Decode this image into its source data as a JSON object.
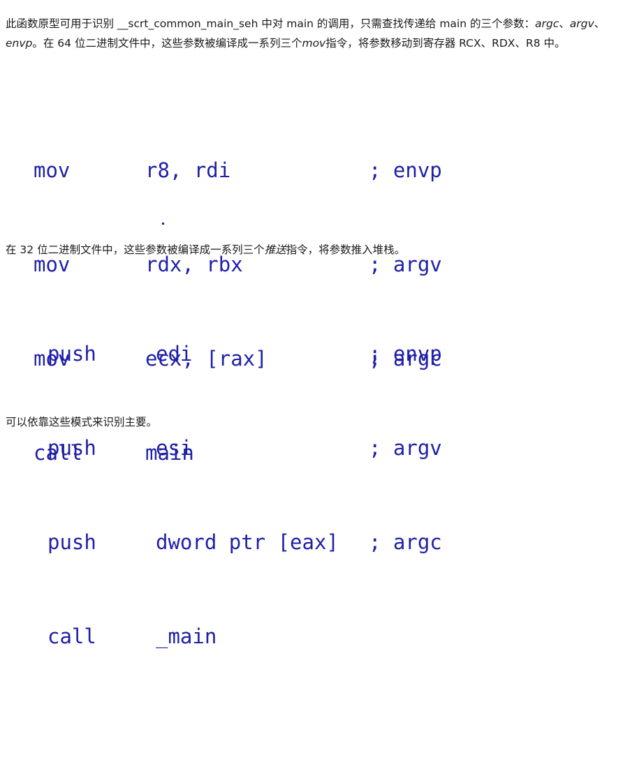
{
  "para1": {
    "a": "此函数原型可用于识别 __scrt_common_main_seh 中对 main 的调用，只需查找传递给 main 的三个参数：",
    "argc": "argc",
    "sep1": "、",
    "argv": "argv",
    "sep2": "、",
    "envp": "envp",
    "b": "。在 64 位二进制文件中，这些参数被编译成一系列三个",
    "mov": "mov",
    "c": "指令，将参数移动到寄存器 RCX、RDX、R8 中。"
  },
  "code64": [
    {
      "op": "mov",
      "args": "r8, rdi",
      "comment": "; envp"
    },
    {
      "op": "mov",
      "args": "rdx, rbx",
      "comment": "; argv"
    },
    {
      "op": "mov",
      "args": "ecx, [rax]",
      "comment": "; argc"
    },
    {
      "op": "call",
      "args": "main",
      "comment": ""
    }
  ],
  "para2": {
    "a": "在 32 位二进制文件中，这些参数被编译成一系列三个",
    "push": "推送",
    "b": "指令，将参数推入堆栈。"
  },
  "code32": [
    {
      "op": "push",
      "args": "edi",
      "comment": "; envp"
    },
    {
      "op": "push",
      "args": "esi",
      "comment": "; argv"
    },
    {
      "op": "push",
      "args": "dword ptr [eax]",
      "comment": "; argc"
    },
    {
      "op": "call",
      "args": "_main",
      "comment": ""
    }
  ],
  "para3": "可以依靠这些模式来识别主要。",
  "colors": {
    "code": "#1f1fa8",
    "text": "#1a1a1a",
    "background": "#ffffff"
  }
}
